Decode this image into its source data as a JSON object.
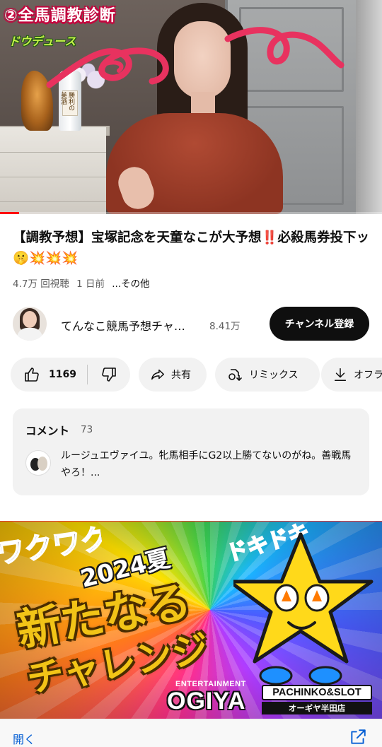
{
  "video": {
    "overlay_title": "②全馬調教診断",
    "overlay_subtitle": "ドウデュース",
    "bottle_label": "勝利の美酒",
    "progress": 0.05,
    "progress_color": "#ff0000"
  },
  "title": "【調教予想】宝塚記念を天童なこが大予想‼️必殺馬券投下ッ🤫💥💥💥",
  "meta": {
    "views": "4.7万 回視聴",
    "age": "1 日前",
    "more": "...その他"
  },
  "channel": {
    "name": "てんなこ競馬予想チャ…",
    "subscribers": "8.41万",
    "subscribe_label": "チャンネル登録"
  },
  "actions": {
    "like_count": "1169",
    "share_label": "共有",
    "remix_label": "リミックス",
    "offline_label": "オフラ"
  },
  "comments": {
    "heading": "コメント",
    "count": "73",
    "top_comment": "ルージュエヴァイユ。牝馬相手にG2以上勝てないのがね。善戦馬やろ！..."
  },
  "ad": {
    "year": "2024夏",
    "line1": "新たなる",
    "line2": "チャレンジ",
    "side_left": "ワクワク",
    "side_right": "ドキドキ",
    "entertainment": "ENTERTAINMENT",
    "brand": "OGIYA",
    "pachinko": "PACHINKO&SLOT",
    "store": "オーギヤ半田店"
  },
  "bottom_bar": {
    "open_label": "開く"
  },
  "colors": {
    "accent": "#065fd4",
    "subscribe_bg": "#0f0f0f",
    "chip_bg": "#f2f2f2",
    "secondary_text": "#606060",
    "scribble": "#e8325f"
  }
}
